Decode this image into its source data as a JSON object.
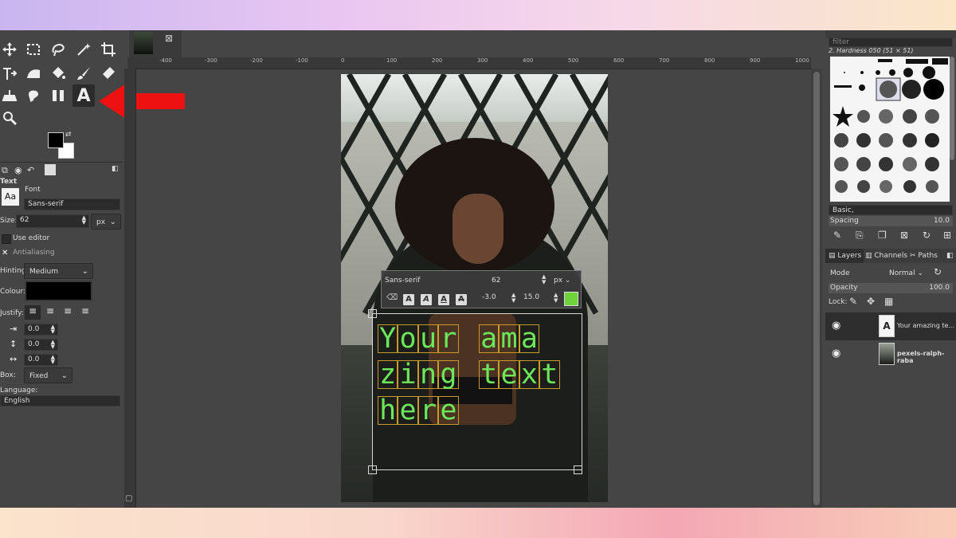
{
  "toolbox": {
    "tool_options_title": "Text",
    "font_label": "Font",
    "font_preview": "Aa",
    "font_value": "Sans-serif",
    "size_label": "Size:",
    "size_value": "62",
    "size_unit": "px",
    "use_editor_label": "Use editor",
    "antialiasing_label": "Antialiasing",
    "hinting_label": "Hinting:",
    "hinting_value": "Medium",
    "colour_label": "Colour:",
    "colour_value": "#000000",
    "justify_label": "Justify:",
    "indent_value": "0.0",
    "line_spacing_value": "0.0",
    "letter_spacing_value": "0.0",
    "box_label": "Box:",
    "box_value": "Fixed",
    "language_label": "Language:",
    "language_value": "English",
    "text_tool_letter": "A"
  },
  "text_editor": {
    "font": "Sans-serif",
    "size": "62",
    "unit": "px",
    "baseline": "-3.0",
    "kerning": "15.0",
    "color": "#6ed23a",
    "style_buttons": [
      "A",
      "A",
      "A",
      "A"
    ]
  },
  "canvas": {
    "ruler_labels": [
      "-400",
      "-300",
      "-200",
      "-100",
      "0",
      "100",
      "200",
      "300",
      "400",
      "500",
      "600",
      "700",
      "800",
      "900",
      "1000"
    ],
    "text_lines": [
      [
        "Y",
        "o",
        "u",
        "r",
        " ",
        "a",
        "m",
        "a"
      ],
      [
        "z",
        "i",
        "n",
        "g",
        " ",
        "t",
        "e",
        "x",
        "t"
      ],
      [
        "h",
        "e",
        "r",
        "e"
      ]
    ]
  },
  "brushes": {
    "filter_placeholder": "filter",
    "current_brush": "2. Hardness 050 (51 × 51)",
    "tag_value": "Basic,",
    "spacing_label": "Spacing",
    "spacing_value": "10.0"
  },
  "layers": {
    "tabs": [
      "Layers",
      "Channels",
      "Paths"
    ],
    "mode_label": "Mode",
    "mode_value": "Normal",
    "opacity_label": "Opacity",
    "opacity_value": "100.0",
    "lock_label": "Lock:",
    "items": [
      {
        "name": "Your amazing te..."
      },
      {
        "name": "pexels-ralph-raba"
      }
    ]
  },
  "colors": {
    "accent_green": "#6ee65a",
    "arrow_red": "#ee1111",
    "gimp_bg": "#454545"
  }
}
